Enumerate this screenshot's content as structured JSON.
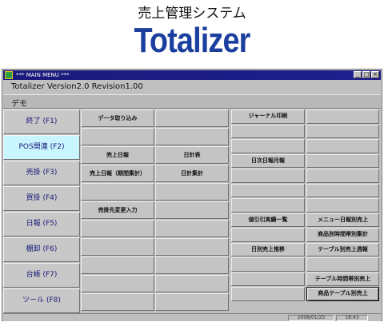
{
  "header": {
    "subtitle": "売上管理システム",
    "title": "Totalizer"
  },
  "window": {
    "title": "*** MAIN MENU ***",
    "version": "Totalizer Version2.0 Revision1.00",
    "company": "デモ",
    "controls": [
      "_",
      "□",
      "×"
    ]
  },
  "left_menu": [
    {
      "label": "終了 (F1)",
      "active": false
    },
    {
      "label": "POS関連 (F2)",
      "active": true
    },
    {
      "label": "売掛 (F3)",
      "active": false
    },
    {
      "label": "買掛 (F4)",
      "active": false
    },
    {
      "label": "日報 (F5)",
      "active": false
    },
    {
      "label": "棚卸 (F6)",
      "active": false
    },
    {
      "label": "台帳 (F7)",
      "active": false
    },
    {
      "label": "ツール (F8)",
      "active": false
    }
  ],
  "grid": {
    "col1": [
      "データ取り込み",
      "",
      "売上日報",
      "売上日報（期間集計）",
      "",
      "売掛先変更入力",
      "",
      "",
      "",
      "",
      ""
    ],
    "col2": [
      "",
      "",
      "日計表",
      "日計集計",
      "",
      "",
      "",
      "",
      "",
      "",
      ""
    ],
    "col3": [
      "ジャーナル印刷",
      "",
      "",
      "日次日報月報",
      "",
      "",
      "",
      "値引引実績一覧",
      "",
      "日別売上推移",
      "",
      "",
      ""
    ],
    "col4": [
      "",
      "",
      "",
      "",
      "",
      "",
      "",
      "メニュー日報別売上",
      "商品別時間帯別集計",
      "テーブル別売上週報",
      "",
      "テーブル時間帯別売上",
      "商品テーブル別売上"
    ]
  },
  "status": {
    "date": "2008/01/25",
    "time": "18:43"
  }
}
